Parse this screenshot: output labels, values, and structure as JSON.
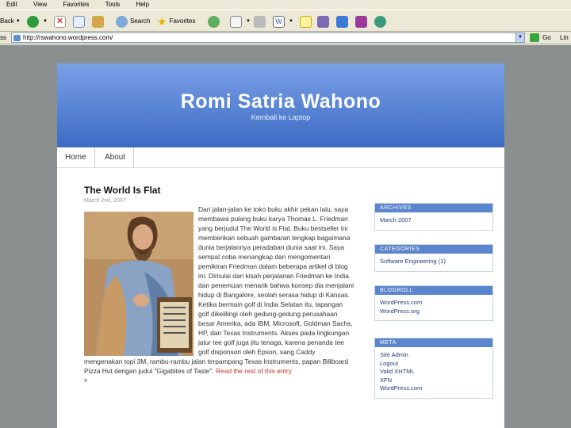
{
  "menu": [
    "Edit",
    "View",
    "Favorites",
    "Tools",
    "Help"
  ],
  "toolbar": {
    "back": "Back",
    "search": "Search",
    "favorites": "Favorites"
  },
  "address": {
    "label": "ss",
    "url": "http://rswahono.wordpress.com/",
    "go": "Go",
    "links": "Lin"
  },
  "blog": {
    "title": "Romi Satria Wahono",
    "description": "Kembali ke Laptop",
    "nav": [
      "Home",
      "About"
    ]
  },
  "post": {
    "title": "The World Is Flat",
    "date": "March 2nd, 2007",
    "body": "Dari jalan-jalan ke toko buku akhir pekan lalu, saya membawa pulang buku karya Thomas L. Friedman yang berjudul The World is Flat. Buku bestseller ini memberikan sebuah gambaran lengkap bagaimana dunia berjalannya peradaban dunia saat ini. Saya sempat coba menangkap dan mengomentari pemikiran Friedman dalam beberapa artikel di blog ini. Dimulai dari kisah perjalanan Friedman ke India dan penemuan menarik bahwa konsep dia menjalani hidup di Bangalore, seolah serasa hidup di Kansas. Ketika bermain golf di India Selatan itu, lapangan golf dikelilingi oleh gedung-gedung perusahaan besar Amerika, ada IBM, Microsoft, Goldman Sachs, HP, dan Texas Instruments. Akses pada lingkungan jalur tee golf juga jitu tenaga, karena penanda tee golf disponsori oleh Epson, sang Caddy mengenakan topi 3M, rambu-rambu jalan terpampang Texas Instruments, papan Billboard Pizza Hut dengan judul \"Gigabites of Taste\".",
    "read_more": "Read the rest of this entry",
    "more_marker": "»"
  },
  "sidebar": {
    "archives": {
      "title": "ARCHIVES",
      "items": [
        "March 2007"
      ]
    },
    "categories": {
      "title": "CATEGORIES",
      "items": [
        "Software Engineering (1)"
      ]
    },
    "blogroll": {
      "title": "BLOGROLL",
      "items": [
        "WordPress.com",
        "WordPress.org"
      ]
    },
    "meta": {
      "title": "META",
      "items": [
        "Site Admin",
        "Logout",
        "Valid XHTML",
        "XFN",
        "WordPress.com"
      ]
    }
  },
  "colors": {
    "header_top": "#7aa0e6",
    "header_bottom": "#3d6bc4",
    "widget_title": "#5b85cc",
    "read_more": "#c0392b",
    "backdrop": "#8a8f8f"
  }
}
